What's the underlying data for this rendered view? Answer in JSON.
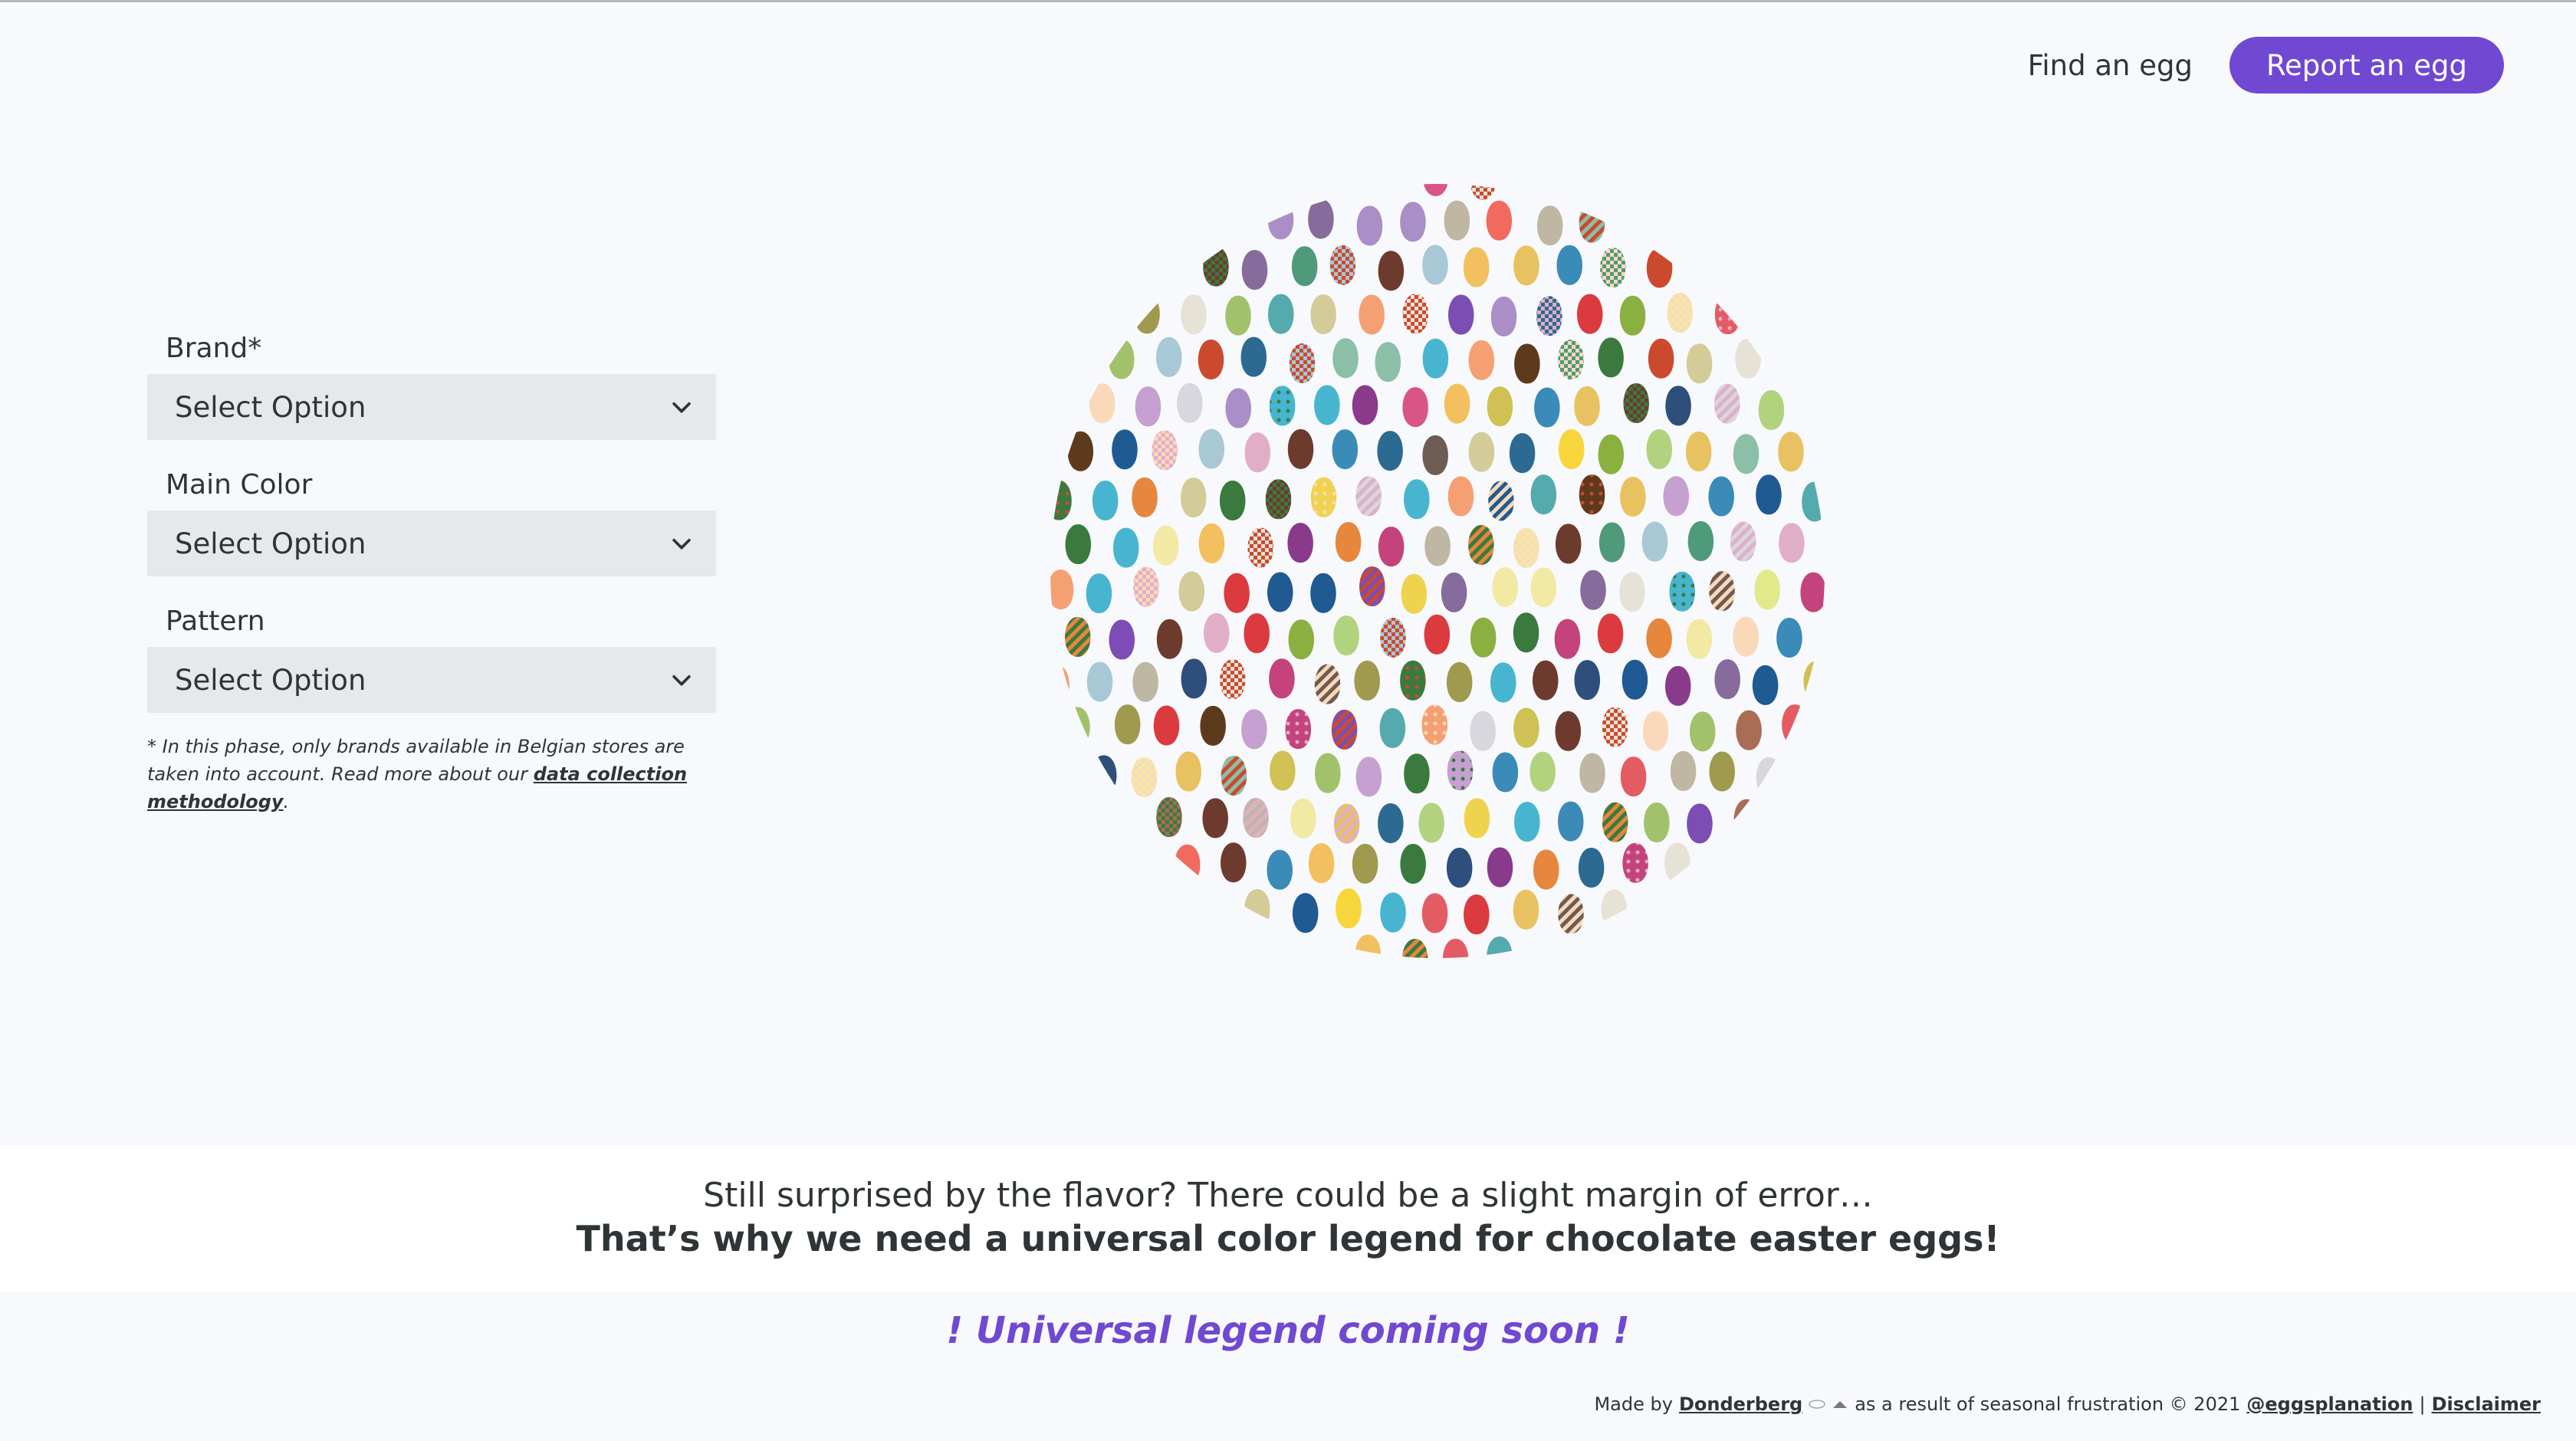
{
  "nav": {
    "find_label": "Find an egg",
    "report_label": "Report an egg"
  },
  "filters": {
    "brand": {
      "label": "Brand*",
      "value": "Select Option"
    },
    "main_color": {
      "label": "Main Color",
      "value": "Select Option"
    },
    "pattern": {
      "label": "Pattern",
      "value": "Select Option"
    },
    "note_prefix": "* In this phase, only brands available in Belgian stores are taken into account. Read more about our ",
    "note_link": "data collection methodology",
    "note_suffix": "."
  },
  "band": {
    "line1": "Still surprised by the flavor? There could be a slight margin of error…",
    "line2": "That’s why we need a universal color legend for chocolate easter eggs!"
  },
  "coming_soon": "! Universal legend coming soon !",
  "footer": {
    "made_by": "Made by",
    "author": "Donderberg",
    "reason": "as a result of seasonal frustration © 2021",
    "handle": "@eggsplanation",
    "separator": "|",
    "disclaimer": "Disclaimer"
  },
  "colors": {
    "accent": "#7048d2",
    "egg_palette": [
      "#e8c261",
      "#8bbfa8",
      "#d85585",
      "#e0afc7",
      "#3b8bb8",
      "#e6e2d5",
      "#6d3b2d",
      "#4f9a7a",
      "#8ab040",
      "#cfc154",
      "#47b5cf",
      "#efd34f",
      "#c4437c",
      "#f2c05e",
      "#cb4a2e",
      "#6e5c54",
      "#d7d7dd",
      "#7c4db4",
      "#f7d63c",
      "#a98ec7",
      "#2d6a92",
      "#a8c8d6",
      "#a96c55",
      "#9f9a4d",
      "#e1ea8a",
      "#3a7a3e",
      "#c5a0d0",
      "#f5a072",
      "#db3a3f",
      "#866b9c",
      "#e7863d",
      "#1f5a92",
      "#bfb6a4",
      "#b1d37e",
      "#d3cc98",
      "#f2e9a4",
      "#fad9ba",
      "#f26a5e",
      "#55aaae",
      "#a1c26a",
      "#e45c63",
      "#5e3a1c",
      "#2e4e7c",
      "#8a3a8b"
    ],
    "egg_pattern_count": 26
  }
}
